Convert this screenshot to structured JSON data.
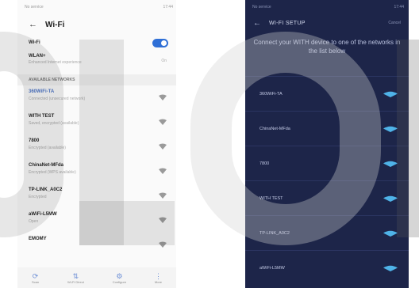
{
  "left": {
    "status": {
      "carrier": "No service",
      "time": "17:44"
    },
    "title": "Wi-Fi",
    "wifi_toggle": {
      "label": "Wi-Fi",
      "on": true
    },
    "wlan_plus": {
      "label": "WLAN+",
      "description": "Enhanced Internet experience",
      "value": "On"
    },
    "section": "AVAILABLE NETWORKS",
    "networks": [
      {
        "name": "360WiFi-TA",
        "status": "Connected (unsecured network)",
        "connected": true
      },
      {
        "name": "WITH TEST",
        "status": "Saved, encrypted (available)",
        "connected": false
      },
      {
        "name": "7800",
        "status": "Encrypted (available)",
        "connected": false
      },
      {
        "name": "ChinaNet-MFda",
        "status": "Encrypted (WPS available)",
        "connected": false
      },
      {
        "name": "TP-LINK_A0C2",
        "status": "Encrypted",
        "connected": false
      },
      {
        "name": "aWiFi-L5MW",
        "status": "Open",
        "connected": false
      },
      {
        "name": "EMOMY",
        "status": "",
        "connected": false
      }
    ],
    "nav": [
      {
        "label": "Scan",
        "icon": "refresh-icon"
      },
      {
        "label": "Wi-Fi Direct",
        "icon": "wifi-direct-icon"
      },
      {
        "label": "Configure",
        "icon": "settings-icon"
      },
      {
        "label": "More",
        "icon": "more-icon"
      }
    ]
  },
  "right": {
    "status": {
      "carrier": "No service",
      "time": "17:44"
    },
    "title": "WI-FI SETUP",
    "cancel_label": "Cancel",
    "intro": "Connect your WITH device to one of the networks in the list below",
    "networks": [
      "360WiFi-TA",
      "ChinaNet-MFda",
      "7800",
      "WITH TEST",
      "TP-LINK_A0C2",
      "aWiFi-L5MW"
    ],
    "accent_color": "#4fb3e8"
  }
}
